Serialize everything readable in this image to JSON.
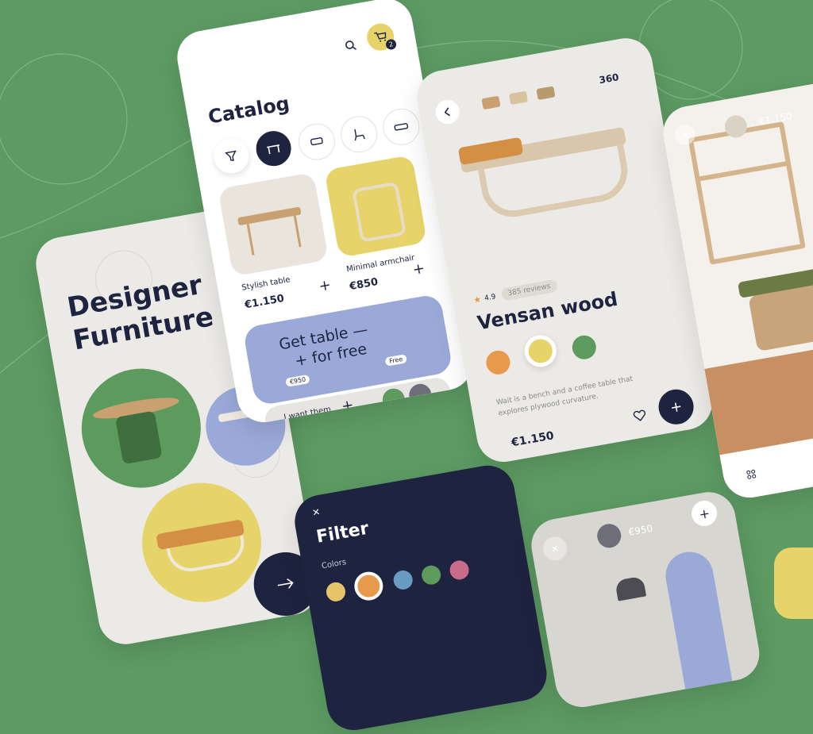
{
  "colors": {
    "background": "#5d9b63",
    "dark": "#1e2440",
    "yellow": "#e6d46a",
    "lavender": "#9aa9d8",
    "green": "#5c9a5e",
    "orange": "#e89a4c"
  },
  "intro": {
    "title_line1": "Designer",
    "title_line2": "Furniture"
  },
  "catalog": {
    "title": "Catalog",
    "cart_count": "2",
    "categories": [
      "filter-icon",
      "table-icon",
      "sofa-icon",
      "chair-icon",
      "couch-icon"
    ],
    "products": [
      {
        "name": "Stylish table",
        "price": "€1.150"
      },
      {
        "name": "Minimal armchair",
        "price": "€850"
      }
    ],
    "promo": {
      "title_line1": "Get table —",
      "title_line2": "+ for free",
      "price_tag": "€950",
      "free_tag": "Free",
      "cta": "I want them"
    }
  },
  "detail": {
    "view_360": "360",
    "rating": "4.9",
    "reviews": "385 reviews",
    "name": "Vensan wood",
    "description_line1": "Wait is a bench and a coffee table that",
    "description_line2": "explores plywood curvature.",
    "price": "€1.150"
  },
  "ar_view": {
    "price": "€1.150"
  },
  "filter": {
    "title": "Filter",
    "colors_label": "Colors"
  },
  "ar_view2": {
    "price": "€950"
  }
}
